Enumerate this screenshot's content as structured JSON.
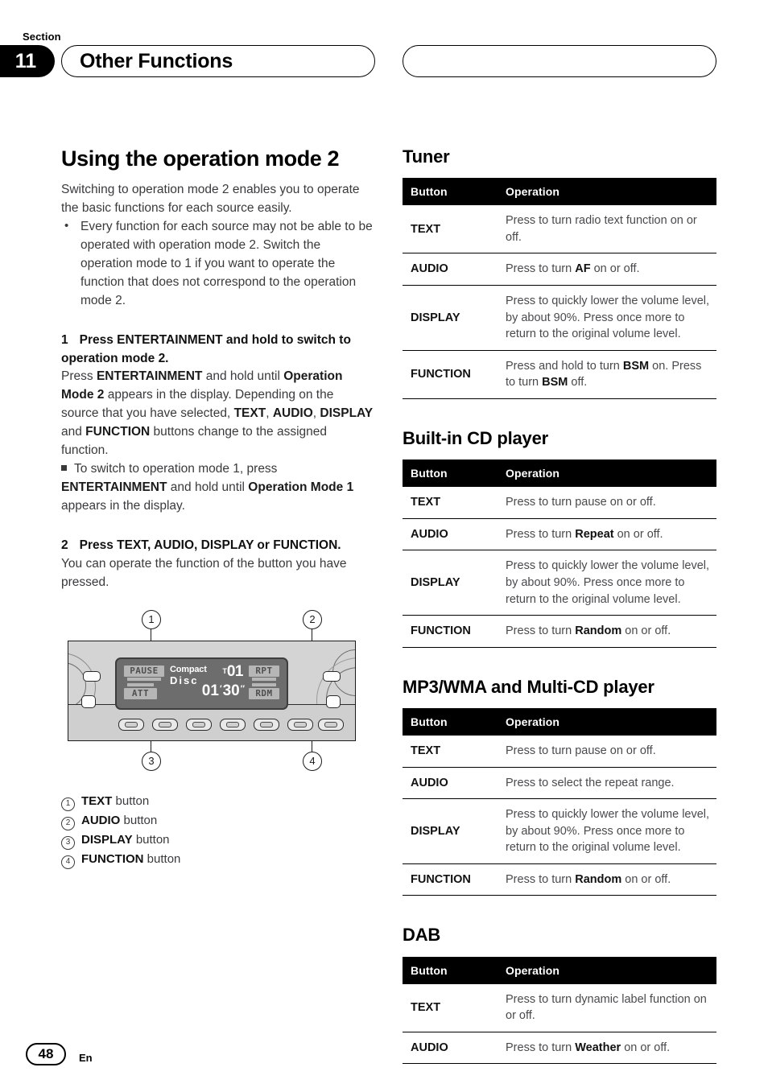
{
  "header": {
    "section_label": "Section",
    "section_number": "11",
    "title": "Other Functions",
    "right_pill_text": ""
  },
  "left_column": {
    "main_title": "Using the operation mode 2",
    "intro": "Switching to operation mode 2 enables you to operate the basic functions for each source easily.",
    "bullets": [
      "Every function for each source may not be able to be operated with operation mode 2. Switch the operation mode to 1 if you want to operate the function that does not correspond to the operation mode 2."
    ],
    "step1": {
      "number": "1",
      "heading": "Press ENTERTAINMENT and hold to switch to operation mode 2.",
      "body_html": "Press <b>ENTERTAINMENT</b> and hold until <b>Operation Mode 2</b> appears in the display. Depending on the source that you have selected, <b>TEXT</b>, <b>AUDIO</b>, <b>DISPLAY</b> and <b>FUNCTION</b> buttons change to the assigned function.",
      "note_html": "To switch to operation mode 1, press <b>ENTERTAINMENT</b> and hold until <b>Operation Mode 1</b> appears in the display."
    },
    "step2": {
      "number": "2",
      "heading": "Press TEXT, AUDIO, DISPLAY or FUNCTION.",
      "body": "You can operate the function of the button you have pressed."
    },
    "diagram": {
      "callouts": [
        "1",
        "2",
        "3",
        "4"
      ],
      "lcd": {
        "pause_indicator": "PAUSE",
        "att_indicator": "ATT",
        "rpt_indicator": "RPT",
        "rdm_indicator": "RDM",
        "disc_label_line1": "Compact",
        "disc_label_line2": "Disc",
        "track_prefix": "T",
        "track_number": "01",
        "time_minutes": "01",
        "time_seconds": "30"
      }
    },
    "legend": [
      {
        "marker": "1",
        "name": "TEXT",
        "suffix": "button"
      },
      {
        "marker": "2",
        "name": "AUDIO",
        "suffix": "button"
      },
      {
        "marker": "3",
        "name": "DISPLAY",
        "suffix": "button"
      },
      {
        "marker": "4",
        "name": "FUNCTION",
        "suffix": "button"
      }
    ]
  },
  "right_column": {
    "tables": [
      {
        "title": "Tuner",
        "columns": [
          "Button",
          "Operation"
        ],
        "rows": [
          {
            "button": "TEXT",
            "operation_html": "Press to turn radio text function on or off."
          },
          {
            "button": "AUDIO",
            "operation_html": "Press to turn <b>AF</b> on or off."
          },
          {
            "button": "DISPLAY",
            "operation_html": "Press to quickly lower the volume level, by about 90%. Press once more to return to the original volume level."
          },
          {
            "button": "FUNCTION",
            "operation_html": "Press and hold to turn <b>BSM</b> on. Press to turn <b>BSM</b> off."
          }
        ]
      },
      {
        "title": "Built-in CD player",
        "columns": [
          "Button",
          "Operation"
        ],
        "rows": [
          {
            "button": "TEXT",
            "operation_html": "Press to turn pause on or off."
          },
          {
            "button": "AUDIO",
            "operation_html": "Press to turn <b>Repeat</b> on or off."
          },
          {
            "button": "DISPLAY",
            "operation_html": "Press to quickly lower the volume level, by about 90%. Press once more to return to the original volume level."
          },
          {
            "button": "FUNCTION",
            "operation_html": "Press to turn <b>Random</b> on or off."
          }
        ]
      },
      {
        "title": "MP3/WMA and Multi-CD player",
        "columns": [
          "Button",
          "Operation"
        ],
        "rows": [
          {
            "button": "TEXT",
            "operation_html": "Press to turn pause on or off."
          },
          {
            "button": "AUDIO",
            "operation_html": "Press to select the repeat range."
          },
          {
            "button": "DISPLAY",
            "operation_html": "Press to quickly lower the volume level, by about 90%. Press once more to return to the original volume level."
          },
          {
            "button": "FUNCTION",
            "operation_html": "Press to turn <b>Random</b> on or off."
          }
        ]
      },
      {
        "title": "DAB",
        "columns": [
          "Button",
          "Operation"
        ],
        "rows": [
          {
            "button": "TEXT",
            "operation_html": "Press to turn dynamic label function on or off."
          },
          {
            "button": "AUDIO",
            "operation_html": "Press to turn <b>Weather</b> on or off."
          }
        ]
      }
    ]
  },
  "footer": {
    "page_number": "48",
    "language": "En"
  }
}
